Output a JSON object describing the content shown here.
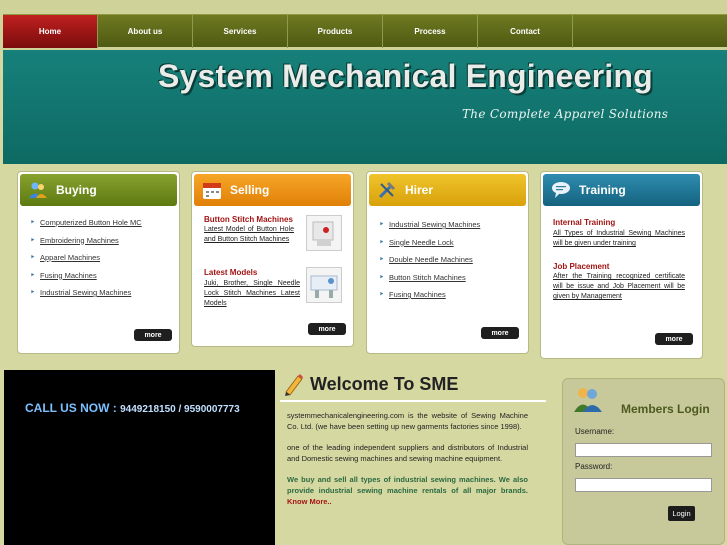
{
  "nav": {
    "items": [
      {
        "label": "Home",
        "active": true
      },
      {
        "label": "About us"
      },
      {
        "label": "Services"
      },
      {
        "label": "Products"
      },
      {
        "label": "Process"
      },
      {
        "label": "Contact"
      }
    ]
  },
  "header": {
    "title": "System Mechanical Engineering",
    "tagline": "The Complete Apparel Solutions"
  },
  "buying": {
    "title": "Buying",
    "icon": "users-icon",
    "links": [
      "Computerized Button Hole MC",
      "Embroidering Machines",
      "Apparel Machines",
      "Fusing Machines",
      "Industrial Sewing Machines"
    ],
    "more": "more"
  },
  "selling": {
    "title": "Selling",
    "icon": "calendar-icon",
    "items": [
      {
        "title": "Button Stitch Machines",
        "text": "Latest Model of Button Hole and Button Stitch Machines"
      },
      {
        "title": "Latest Models",
        "text": "Juki, Brother, Single Needle Lock Stitch Machines Latest Models"
      }
    ],
    "more": "more"
  },
  "hirer": {
    "title": "Hirer",
    "icon": "tools-icon",
    "links": [
      "Industrial Sewing Machines",
      "Single Needle Lock",
      "Double Needle Machines",
      "Button Stitch Machines",
      "Fusing Machines"
    ],
    "more": "more"
  },
  "training": {
    "title": "Training",
    "icon": "chat-icon",
    "items": [
      {
        "title": "Internal Training",
        "text": "All Types of Industrial Sewing Machines will be given under training"
      },
      {
        "title": "Job Placement",
        "text": "After the Training recognized certificate will be issue and Job Placement will be given by Management"
      }
    ],
    "more": "more"
  },
  "call": {
    "label": "CALL US NOW : ",
    "numbers": "9449218150 / 9590007773"
  },
  "welcome": {
    "title": "Welcome To SME",
    "p1": "systemmechanicalengineering.com is the website of Sewing Machine Co. Ltd. (we have been setting up new garments factories since 1998).",
    "p2": "one of the leading independent suppliers and distributors of Industrial and Domestic sewing machines and sewing machine equipment.",
    "p3": "We buy and sell all types of industrial sewing machines. We also provide industrial sewing machine rentals of all major brands.",
    "know_more": "Know More.."
  },
  "members": {
    "title": "Members Login",
    "username_label": "Username:",
    "password_label": "Password:",
    "login": "Login"
  },
  "colors": {
    "header_bg": "#0f6f68",
    "nav_bg": "#5f6a1a",
    "nav_active": "#a31414",
    "page_bg": "#d6d8a2",
    "accent_red": "#a31414"
  }
}
